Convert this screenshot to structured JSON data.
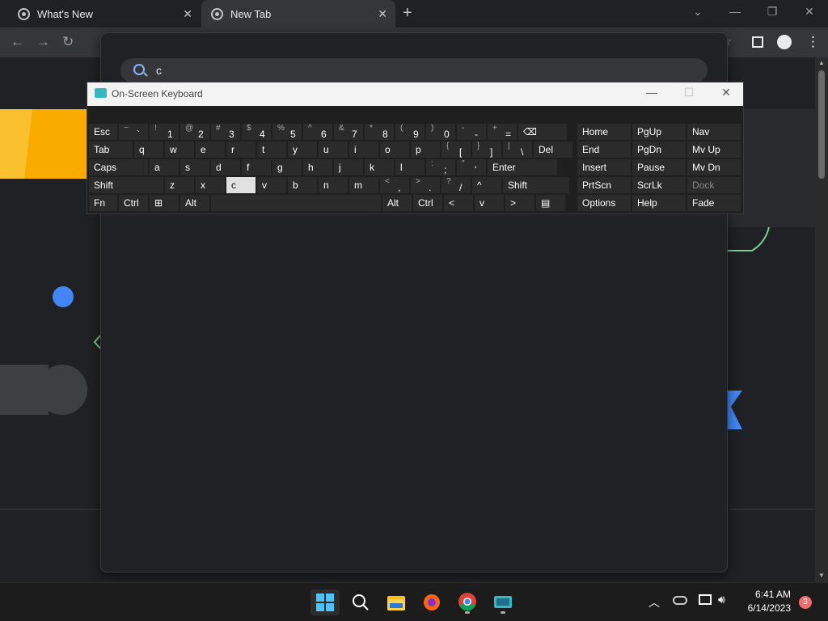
{
  "browser": {
    "tabs": [
      {
        "label": "What's New",
        "close": "✕"
      },
      {
        "label": "New Tab",
        "close": "✕"
      }
    ],
    "new_tab": "+",
    "window_controls": {
      "minimize": "—",
      "restore": "❐",
      "close": "✕",
      "tab_search": "⌄"
    }
  },
  "omnibox": {
    "query": "c"
  },
  "osk": {
    "title": "On-Screen Keyboard",
    "controls": {
      "minimize": "—",
      "maximize": "☐",
      "close": "✕"
    },
    "rows": [
      [
        {
          "m": "Esc"
        },
        {
          "s": "~",
          "p": "`"
        },
        {
          "s": "!",
          "p": "1"
        },
        {
          "s": "@",
          "p": "2"
        },
        {
          "s": "#",
          "p": "3"
        },
        {
          "s": "$",
          "p": "4"
        },
        {
          "s": "%",
          "p": "5"
        },
        {
          "s": "^",
          "p": "6"
        },
        {
          "s": "&",
          "p": "7"
        },
        {
          "s": "*",
          "p": "8"
        },
        {
          "s": "(",
          "p": "9"
        },
        {
          "s": ")",
          "p": "0"
        },
        {
          "s": "-",
          "p": "-"
        },
        {
          "s": "+",
          "p": "="
        },
        {
          "m": "⌫"
        }
      ],
      [
        {
          "m": "Tab"
        },
        {
          "m": "q"
        },
        {
          "m": "w"
        },
        {
          "m": "e"
        },
        {
          "m": "r"
        },
        {
          "m": "t"
        },
        {
          "m": "y"
        },
        {
          "m": "u"
        },
        {
          "m": "i"
        },
        {
          "m": "o"
        },
        {
          "m": "p"
        },
        {
          "s": "{",
          "p": "["
        },
        {
          "s": "}",
          "p": "]"
        },
        {
          "s": "|",
          "p": "\\"
        },
        {
          "m": "Del"
        }
      ],
      [
        {
          "m": "Caps"
        },
        {
          "m": "a"
        },
        {
          "m": "s"
        },
        {
          "m": "d"
        },
        {
          "m": "f"
        },
        {
          "m": "g"
        },
        {
          "m": "h"
        },
        {
          "m": "j"
        },
        {
          "m": "k"
        },
        {
          "m": "l"
        },
        {
          "s": ":",
          "p": ";"
        },
        {
          "s": "\"",
          "p": "'"
        },
        {
          "m": "Enter"
        }
      ],
      [
        {
          "m": "Shift"
        },
        {
          "m": "z"
        },
        {
          "m": "x"
        },
        {
          "m": "c"
        },
        {
          "m": "v"
        },
        {
          "m": "b"
        },
        {
          "m": "n"
        },
        {
          "m": "m"
        },
        {
          "s": "<",
          "p": ","
        },
        {
          "s": ">",
          "p": "."
        },
        {
          "s": "?",
          "p": "/"
        },
        {
          "m": "^"
        },
        {
          "m": "Shift"
        }
      ],
      [
        {
          "m": "Fn"
        },
        {
          "m": "Ctrl"
        },
        {
          "m": "⊞"
        },
        {
          "m": "Alt"
        },
        {
          "m": ""
        },
        {
          "m": "Alt"
        },
        {
          "m": "Ctrl"
        },
        {
          "m": "<"
        },
        {
          "m": "v"
        },
        {
          "m": ">"
        },
        {
          "m": "▤"
        }
      ]
    ],
    "right_keys": [
      [
        "Home",
        "PgUp",
        "Nav"
      ],
      [
        "End",
        "PgDn",
        "Mv Up"
      ],
      [
        "Insert",
        "Pause",
        "Mv Dn"
      ],
      [
        "PrtScn",
        "ScrLk",
        "Dock"
      ],
      [
        "Options",
        "Help",
        "Fade"
      ]
    ]
  },
  "taskbar": {
    "time": "6:41 AM",
    "date": "6/14/2023",
    "notification_count": "3"
  }
}
